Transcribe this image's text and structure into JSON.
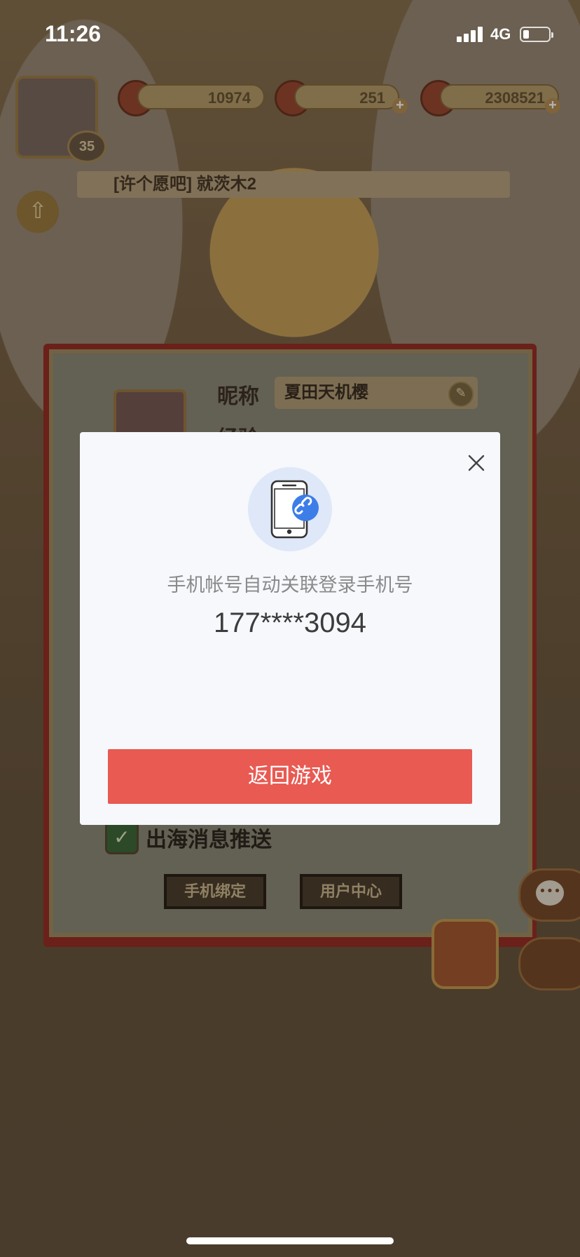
{
  "status_bar": {
    "time": "11:26",
    "network": "4G"
  },
  "game": {
    "resources": [
      {
        "icon": "flower-icon",
        "value": "10974"
      },
      {
        "icon": "gem-icon",
        "value": "251"
      },
      {
        "icon": "coin-icon",
        "value": "2308521"
      }
    ],
    "player_level": "35",
    "banner_text": "[许个愿吧] 就茨木2",
    "profile": {
      "nickname_label": "昵称",
      "nickname_value": "夏田天机樱",
      "exp_label": "经验",
      "push_label": "出海消息推送",
      "bind_phone_button": "手机绑定",
      "user_center_button": "用户中心"
    }
  },
  "dialog": {
    "message": "手机帐号自动关联登录手机号",
    "phone_number": "177****3094",
    "return_button": "返回游戏"
  },
  "colors": {
    "accent_button": "#e85a52",
    "dialog_background": "#f6f8fc",
    "icon_blue": "#3d7de8"
  }
}
